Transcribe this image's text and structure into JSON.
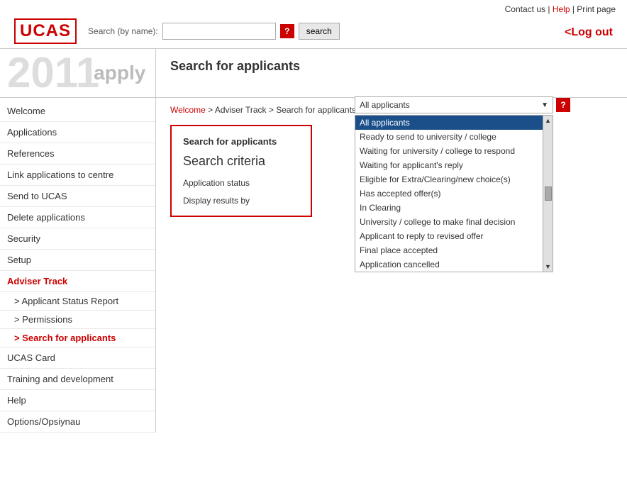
{
  "header": {
    "logo": "UCAS",
    "links": {
      "contact": "Contact us",
      "separator1": " | ",
      "help": "Help",
      "separator2": " | ",
      "print": "Print page"
    },
    "logout": "<Log out"
  },
  "search_bar": {
    "label": "Search (by name):",
    "placeholder": "",
    "help_label": "?",
    "button_label": "search"
  },
  "banner": {
    "year": "2011",
    "apply": "apply"
  },
  "page_title": "Search for applicants",
  "breadcrumb": {
    "welcome": "Welcome",
    "sep1": " > ",
    "adviser_track": "Adviser Track",
    "sep2": " > ",
    "current": "Search for applicants"
  },
  "sidebar": {
    "items": [
      {
        "label": "Welcome",
        "type": "item",
        "active": false
      },
      {
        "label": "Applications",
        "type": "item",
        "active": false
      },
      {
        "label": "References",
        "type": "item",
        "active": false
      },
      {
        "label": "Link applications to centre",
        "type": "item",
        "active": false
      },
      {
        "label": "Send to UCAS",
        "type": "item",
        "active": false
      },
      {
        "label": "Delete applications",
        "type": "item",
        "active": false
      },
      {
        "label": "Security",
        "type": "item",
        "active": false
      },
      {
        "label": "Setup",
        "type": "item",
        "active": false
      },
      {
        "label": "Adviser Track",
        "type": "section",
        "active": false
      },
      {
        "label": "> Applicant Status Report",
        "type": "subitem",
        "active": false
      },
      {
        "label": "> Permissions",
        "type": "subitem",
        "active": false
      },
      {
        "label": "> Search for applicants",
        "type": "subitem",
        "active": true
      },
      {
        "label": "UCAS Card",
        "type": "item",
        "active": false
      },
      {
        "label": "Training and development",
        "type": "item",
        "active": false
      },
      {
        "label": "Help",
        "type": "item",
        "active": false
      },
      {
        "label": "Options/Opsiynau",
        "type": "item",
        "active": false
      }
    ]
  },
  "search_form": {
    "title": "Search for applicants",
    "criteria_heading": "Search criteria",
    "application_status_label": "Application status",
    "display_results_label": "Display results by",
    "help_btn": "?"
  },
  "dropdown": {
    "selected_label": "All applicants",
    "options": [
      {
        "label": "All applicants",
        "selected": true
      },
      {
        "label": "Ready to send to university / college",
        "selected": false
      },
      {
        "label": "Waiting for university / college to respond",
        "selected": false
      },
      {
        "label": "Waiting for applicant's reply",
        "selected": false
      },
      {
        "label": "Eligible for Extra/Clearing/new choice(s)",
        "selected": false
      },
      {
        "label": "Has accepted offer(s)",
        "selected": false
      },
      {
        "label": "In Clearing",
        "selected": false
      },
      {
        "label": "University / college to make final decision",
        "selected": false
      },
      {
        "label": "Applicant to reply to revised offer",
        "selected": false
      },
      {
        "label": "Final place accepted",
        "selected": false
      },
      {
        "label": "Application cancelled",
        "selected": false
      }
    ]
  }
}
